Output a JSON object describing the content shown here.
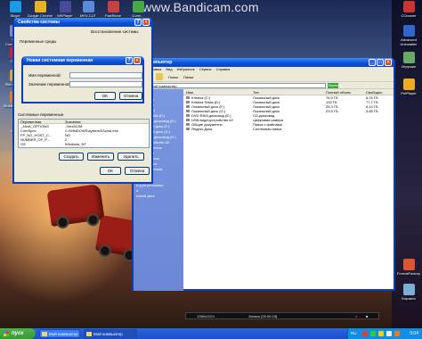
{
  "watermark": "www.Bandicam.com",
  "desktop_icons": [
    {
      "label": "Skype",
      "color": "#1a9be6"
    },
    {
      "label": "Google Chrome",
      "color": "#e8b321"
    },
    {
      "label": "MKPlayer",
      "color": "#4a4a9a"
    },
    {
      "label": "MKV-CUT",
      "color": "#5a8ad8"
    },
    {
      "label": "FastStone Capture",
      "color": "#c84040"
    },
    {
      "label": "Corel...",
      "color": "#44aa44"
    },
    {
      "label": "Total Commander",
      "color": "#8888cc"
    },
    {
      "label": "Opera",
      "color": "#dd2222"
    },
    {
      "label": "Skins Studio",
      "color": "#ddaa22"
    },
    {
      "label": "Mozilla Firefox",
      "color": "#e87a22"
    },
    {
      "label": "Игры",
      "color": "#888888"
    },
    {
      "label": "CCleaner",
      "color": "#cc3333"
    },
    {
      "label": "Advanced Uninstaller",
      "color": "#3366cc"
    },
    {
      "label": "Игрушки",
      "color": "#66aa66"
    },
    {
      "label": "PotPlayer",
      "color": "#eeaa22"
    },
    {
      "label": "FormatFactory",
      "color": "#dd5533"
    },
    {
      "label": "Корзина",
      "color": "#7ab0d8"
    }
  ],
  "sysprops": {
    "title": "Свойства системы",
    "tab": "Восстановление системы",
    "section_user": "Переменные среды",
    "section_system": "Системные переменные",
    "columns": [
      "Переменная",
      "Значение"
    ],
    "rows": [
      [
        "_JAVA_OPTIONS",
        "-Xmx512M"
      ],
      [
        "ComSpec",
        "C:\\WINDOWS\\system32\\cmd.exe"
      ],
      [
        "FP_NO_HOST_C...",
        "NO"
      ],
      [
        "NUMBER_OF_P...",
        "2"
      ],
      [
        "OS",
        "Windows_NT"
      ]
    ],
    "buttons": {
      "create": "Создать",
      "edit": "Изменить",
      "delete": "Удалить",
      "ok": "OK",
      "cancel": "Отмена"
    }
  },
  "newvar": {
    "title": "Новая системная переменная",
    "name_label": "Имя переменной:",
    "value_label": "Значение переменной:",
    "ok": "OK",
    "cancel": "Отмена"
  },
  "explorer": {
    "title": "Мой компьютер",
    "menu": [
      "Файл",
      "Правка",
      "Вид",
      "Избранное",
      "Сервис",
      "Справка"
    ],
    "toolbar": {
      "search": "Поиск",
      "folders": "Папки"
    },
    "address_label": "Адрес",
    "address_value": "Мой компьютер",
    "go_label": "Переход",
    "left_items": [
      "стол",
      "документы",
      "компьютер",
      "Kristina (C:)",
      "Kristina Tekila (D:)",
      "DVD-RAM дисковод (E:)",
      "Локальный диск (F:)",
      "Локальный диск (G:)",
      "DVD-RAM дисковод (H:)",
      "видеоустройство #2",
      "вые документы",
      "документы",
      "ие документы",
      "Яндекс.Диск",
      "ель управления",
      "вые папки",
      "зина",
      "ы для установки",
      "я",
      "ьчный диск"
    ],
    "columns": [
      "Имя",
      "Тип",
      "Полный объем",
      "Свободно"
    ],
    "rows": [
      {
        "name": "Kristina (C:)",
        "type": "Локальный диск",
        "total": "76,9 ГБ",
        "free": "6,23 ГБ"
      },
      {
        "name": "Kristina Tekila (D:)",
        "type": "Локальный диск",
        "total": "133 ГБ",
        "free": "77,7 ГБ"
      },
      {
        "name": "Локальный диск (F:)",
        "type": "Локальный диск",
        "total": "25,3 ГБ",
        "free": "6,14 ГБ"
      },
      {
        "name": "Локальный диск (G:)",
        "type": "Локальный диск",
        "total": "23,5 ГБ",
        "free": "3,65 ГБ"
      },
      {
        "name": "DVD-RAM дисковод (E:)",
        "type": "CD-дисковод",
        "total": "",
        "free": ""
      },
      {
        "name": "USB-видеоустройство #2",
        "type": "Цифровая камера",
        "total": "",
        "free": ""
      },
      {
        "name": "Общие документы",
        "type": "Папка с файлами",
        "total": "",
        "free": ""
      },
      {
        "name": "Яндекс.Диск",
        "type": "Системная папка",
        "total": "",
        "free": ""
      }
    ]
  },
  "bandicam": {
    "resolution": "1280x1024",
    "status": "Запись [00:00:23]"
  },
  "taskbar": {
    "start": "пуск",
    "tasks": [
      "Мой компьютер",
      "Мой компьютер"
    ],
    "lang": "RU",
    "clock": "0:04"
  }
}
